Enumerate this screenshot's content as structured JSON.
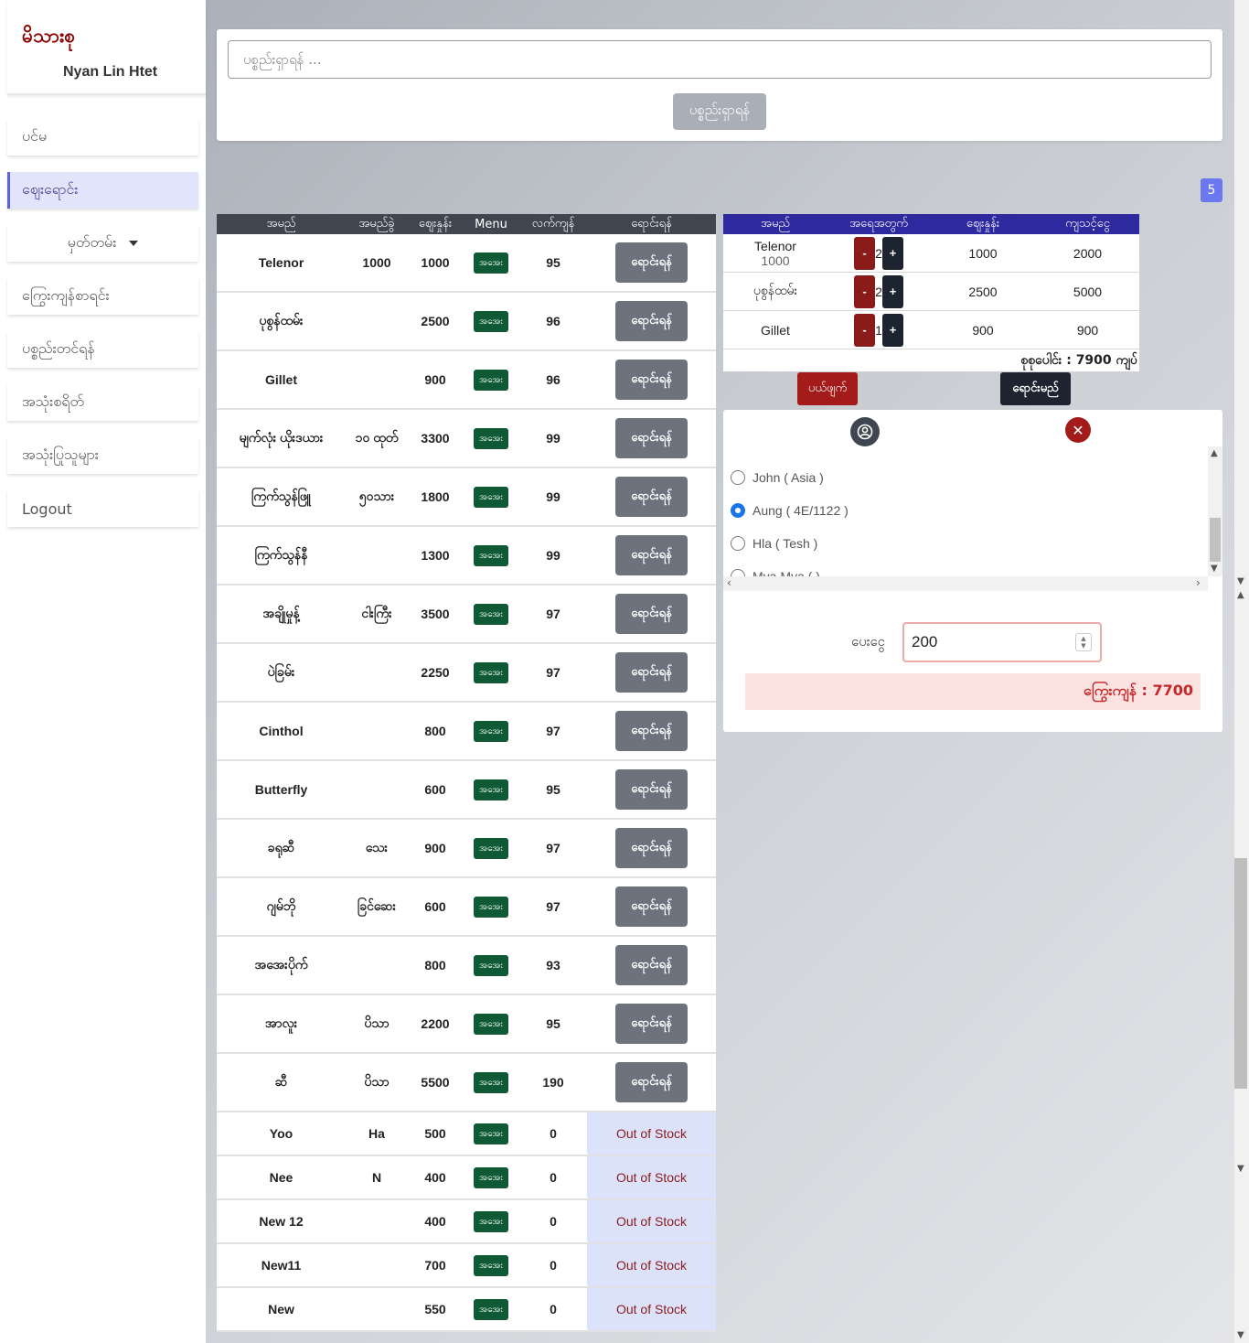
{
  "app": {
    "logo": "မိသားစု",
    "user": "Nyan Lin Htet"
  },
  "sidebar": {
    "items": [
      {
        "label": "ပင်မ"
      },
      {
        "label": "ဈေးရောင်း"
      },
      {
        "label": "မှတ်တမ်း"
      },
      {
        "label": "ကြွေးကျန်စာရင်း"
      },
      {
        "label": "ပစ္စည်းတင်ရန်"
      },
      {
        "label": "အသုံးစရိတ်"
      },
      {
        "label": "အသုံးပြုသူများ"
      },
      {
        "label": "Logout"
      }
    ]
  },
  "search": {
    "placeholder": "ပစ္စည်းရှာရန် ...",
    "button": "ပစ္စည်းရှာရန်"
  },
  "badge": "5",
  "products": {
    "headers": [
      "အမည်",
      "အမည်ခွဲ",
      "ဈေးနှုန်း",
      "Menu",
      "လက်ကျန်",
      "ရောင်းရန်"
    ],
    "menu_label": "အအေး",
    "buy_label": "ရောင်းရန်",
    "out_label": "Out of Stock",
    "rows": [
      {
        "name": "Telenor",
        "sub": "1000",
        "price": "1000",
        "stock": "95"
      },
      {
        "name": "ပုစွန်ထမ်း",
        "sub": "",
        "price": "2500",
        "stock": "96"
      },
      {
        "name": "Gillet",
        "sub": "",
        "price": "900",
        "stock": "96"
      },
      {
        "name": "မျက်လုံး ယိုးဒယား",
        "sub": "၁၀ ထုတ်",
        "price": "3300",
        "stock": "99"
      },
      {
        "name": "ကြက်သွန်ဖြူ",
        "sub": "၅၀သား",
        "price": "1800",
        "stock": "99"
      },
      {
        "name": "ကြက်သွန်နီ",
        "sub": "",
        "price": "1300",
        "stock": "99"
      },
      {
        "name": "အချိုမှုန့်",
        "sub": "ငါးကြီး",
        "price": "3500",
        "stock": "97"
      },
      {
        "name": "ပဲခြမ်း",
        "sub": "",
        "price": "2250",
        "stock": "97"
      },
      {
        "name": "Cinthol",
        "sub": "",
        "price": "800",
        "stock": "97"
      },
      {
        "name": "Butterfly",
        "sub": "",
        "price": "600",
        "stock": "95"
      },
      {
        "name": "ခရုဆီ",
        "sub": "သေး",
        "price": "900",
        "stock": "97"
      },
      {
        "name": "ဂျမ်ဘို",
        "sub": "ခြင်ဆေး",
        "price": "600",
        "stock": "97"
      },
      {
        "name": "အအေးပိုက်",
        "sub": "",
        "price": "800",
        "stock": "93"
      },
      {
        "name": "အာလူး",
        "sub": "ပိသာ",
        "price": "2200",
        "stock": "95"
      },
      {
        "name": "ဆီ",
        "sub": "ပိသာ",
        "price": "5500",
        "stock": "190"
      },
      {
        "name": "Yoo",
        "sub": "Ha",
        "price": "500",
        "stock": "0"
      },
      {
        "name": "Nee",
        "sub": "N",
        "price": "400",
        "stock": "0"
      },
      {
        "name": "New 12",
        "sub": "",
        "price": "400",
        "stock": "0"
      },
      {
        "name": "New11",
        "sub": "",
        "price": "700",
        "stock": "0"
      },
      {
        "name": "New",
        "sub": "",
        "price": "550",
        "stock": "0"
      }
    ]
  },
  "cart": {
    "headers": [
      "အမည်",
      "အရေအတွက်",
      "ဈေးနှုန်း",
      "ကျသင့်ငွေ"
    ],
    "rows": [
      {
        "name": "Telenor",
        "sub": "1000",
        "qty": "2",
        "price": "1000",
        "amount": "2000"
      },
      {
        "name": "ပုစွန်ထမ်း",
        "sub": "",
        "qty": "2",
        "price": "2500",
        "amount": "5000"
      },
      {
        "name": "Gillet",
        "sub": "",
        "qty": "1",
        "price": "900",
        "amount": "900"
      }
    ],
    "total": "စုစုပေါင်း : 7900 ကျပ်",
    "cancel": "ပယ်ဖျက်",
    "checkout": "ရောင်းမည်"
  },
  "customers": {
    "items": [
      {
        "label": "John ( Asia )",
        "selected": false
      },
      {
        "label": "Aung ( 4E/1122 )",
        "selected": true
      },
      {
        "label": "Hla ( Tesh )",
        "selected": false
      },
      {
        "label": "Mya Mya ( )",
        "selected": false
      }
    ],
    "pay_label": "ပေးငွေ",
    "pay_value": "200",
    "change": "ကြွေးကျန် : 7700"
  },
  "colors": {
    "product_header": "#3f4650",
    "cart_header": "#2f29a0",
    "menu_badge": "#0f5a34",
    "danger": "#a31b1b",
    "dark": "#1d2430",
    "out_of_stock_bg": "#dde2fb"
  },
  "icons": {
    "customer": "user-circle-icon",
    "close": "close-icon"
  }
}
